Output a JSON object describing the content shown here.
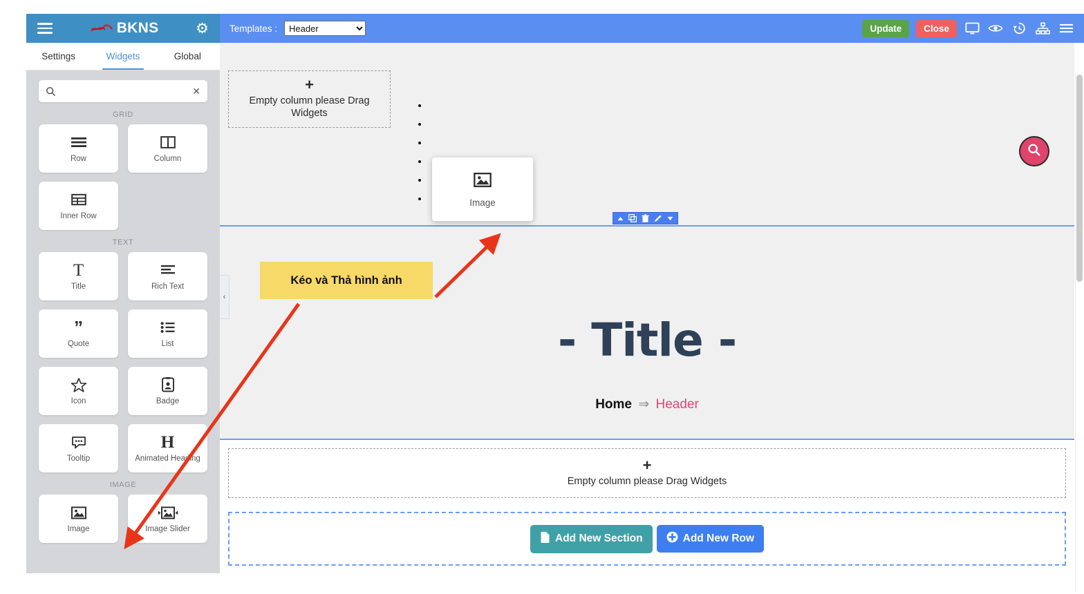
{
  "sidebar": {
    "brand": {
      "title": "BKNS",
      "logo_icon": "bkns-logo-icon",
      "menu_icon": "hamburger-icon",
      "settings_icon": "gear-icon"
    },
    "tabs": [
      {
        "label": "Settings",
        "active": false
      },
      {
        "label": "Widgets",
        "active": true
      },
      {
        "label": "Global",
        "active": false
      }
    ],
    "search": {
      "value": "",
      "placeholder": "",
      "search_icon": "search-icon",
      "clear_icon": "close-icon"
    },
    "groups": [
      {
        "label": "GRID",
        "widgets": [
          {
            "label": "Row",
            "icon": "rows-icon"
          },
          {
            "label": "Column",
            "icon": "columns-icon"
          },
          {
            "label": "Inner Row",
            "icon": "table-icon"
          }
        ]
      },
      {
        "label": "TEXT",
        "widgets": [
          {
            "label": "Title",
            "icon": "text-title-icon"
          },
          {
            "label": "Rich Text",
            "icon": "align-left-icon"
          },
          {
            "label": "Quote",
            "icon": "quote-icon"
          },
          {
            "label": "List",
            "icon": "list-icon"
          },
          {
            "label": "Icon",
            "icon": "star-icon"
          },
          {
            "label": "Badge",
            "icon": "badge-icon"
          },
          {
            "label": "Tooltip",
            "icon": "tooltip-icon"
          },
          {
            "label": "Animated Heading",
            "icon": "heading-h-icon"
          }
        ]
      },
      {
        "label": "IMAGE",
        "widgets": [
          {
            "label": "Image",
            "icon": "image-icon"
          },
          {
            "label": "Image Slider",
            "icon": "image-slider-icon"
          }
        ]
      }
    ],
    "collapse_handle": "‹"
  },
  "topbar": {
    "templates_label": "Templates :",
    "template_selected": "Header",
    "template_options": [
      "Header"
    ],
    "update_label": "Update",
    "close_label": "Close",
    "icons": [
      {
        "name": "desktop-icon"
      },
      {
        "name": "eye-icon"
      },
      {
        "name": "history-icon"
      },
      {
        "name": "sitemap-icon"
      },
      {
        "name": "menu-icon"
      }
    ]
  },
  "canvas": {
    "empty_column_top": {
      "plus": "+",
      "text": "Empty column please Drag Widgets"
    },
    "empty_column_bottom": {
      "plus": "+",
      "text": "Empty column please Drag Widgets"
    },
    "bullets": [
      "",
      "",
      "",
      "",
      "",
      ""
    ],
    "hero_title": "- Title -",
    "breadcrumb": {
      "home": "Home",
      "arrow": "⇒",
      "current": "Header"
    },
    "search_fab_icon": "search-icon",
    "widget_toolbar_icons": [
      {
        "name": "caret-up-icon"
      },
      {
        "name": "duplicate-icon"
      },
      {
        "name": "trash-icon"
      },
      {
        "name": "pencil-icon"
      },
      {
        "name": "caret-down-icon"
      }
    ],
    "add_section_label": "Add New Section",
    "add_row_label": "Add New Row"
  },
  "drag_ghost": {
    "label": "Image",
    "icon": "image-icon"
  },
  "annotation": {
    "text": "Kéo và Thả hình ảnh"
  },
  "colors": {
    "sidebar_header": "#3e8fc4",
    "topbar": "#5a8ef0",
    "update": "#5aa34a",
    "close": "#ef6060",
    "accent_tab": "#4a90e2",
    "title": "#2f4158",
    "breadcrumb_current": "#e8436f",
    "search_fab": "#e0436b",
    "add_section": "#40a0a8",
    "add_row": "#3d7ff0",
    "annotation_bg": "#f7d967",
    "arrow": "#e8351a"
  }
}
